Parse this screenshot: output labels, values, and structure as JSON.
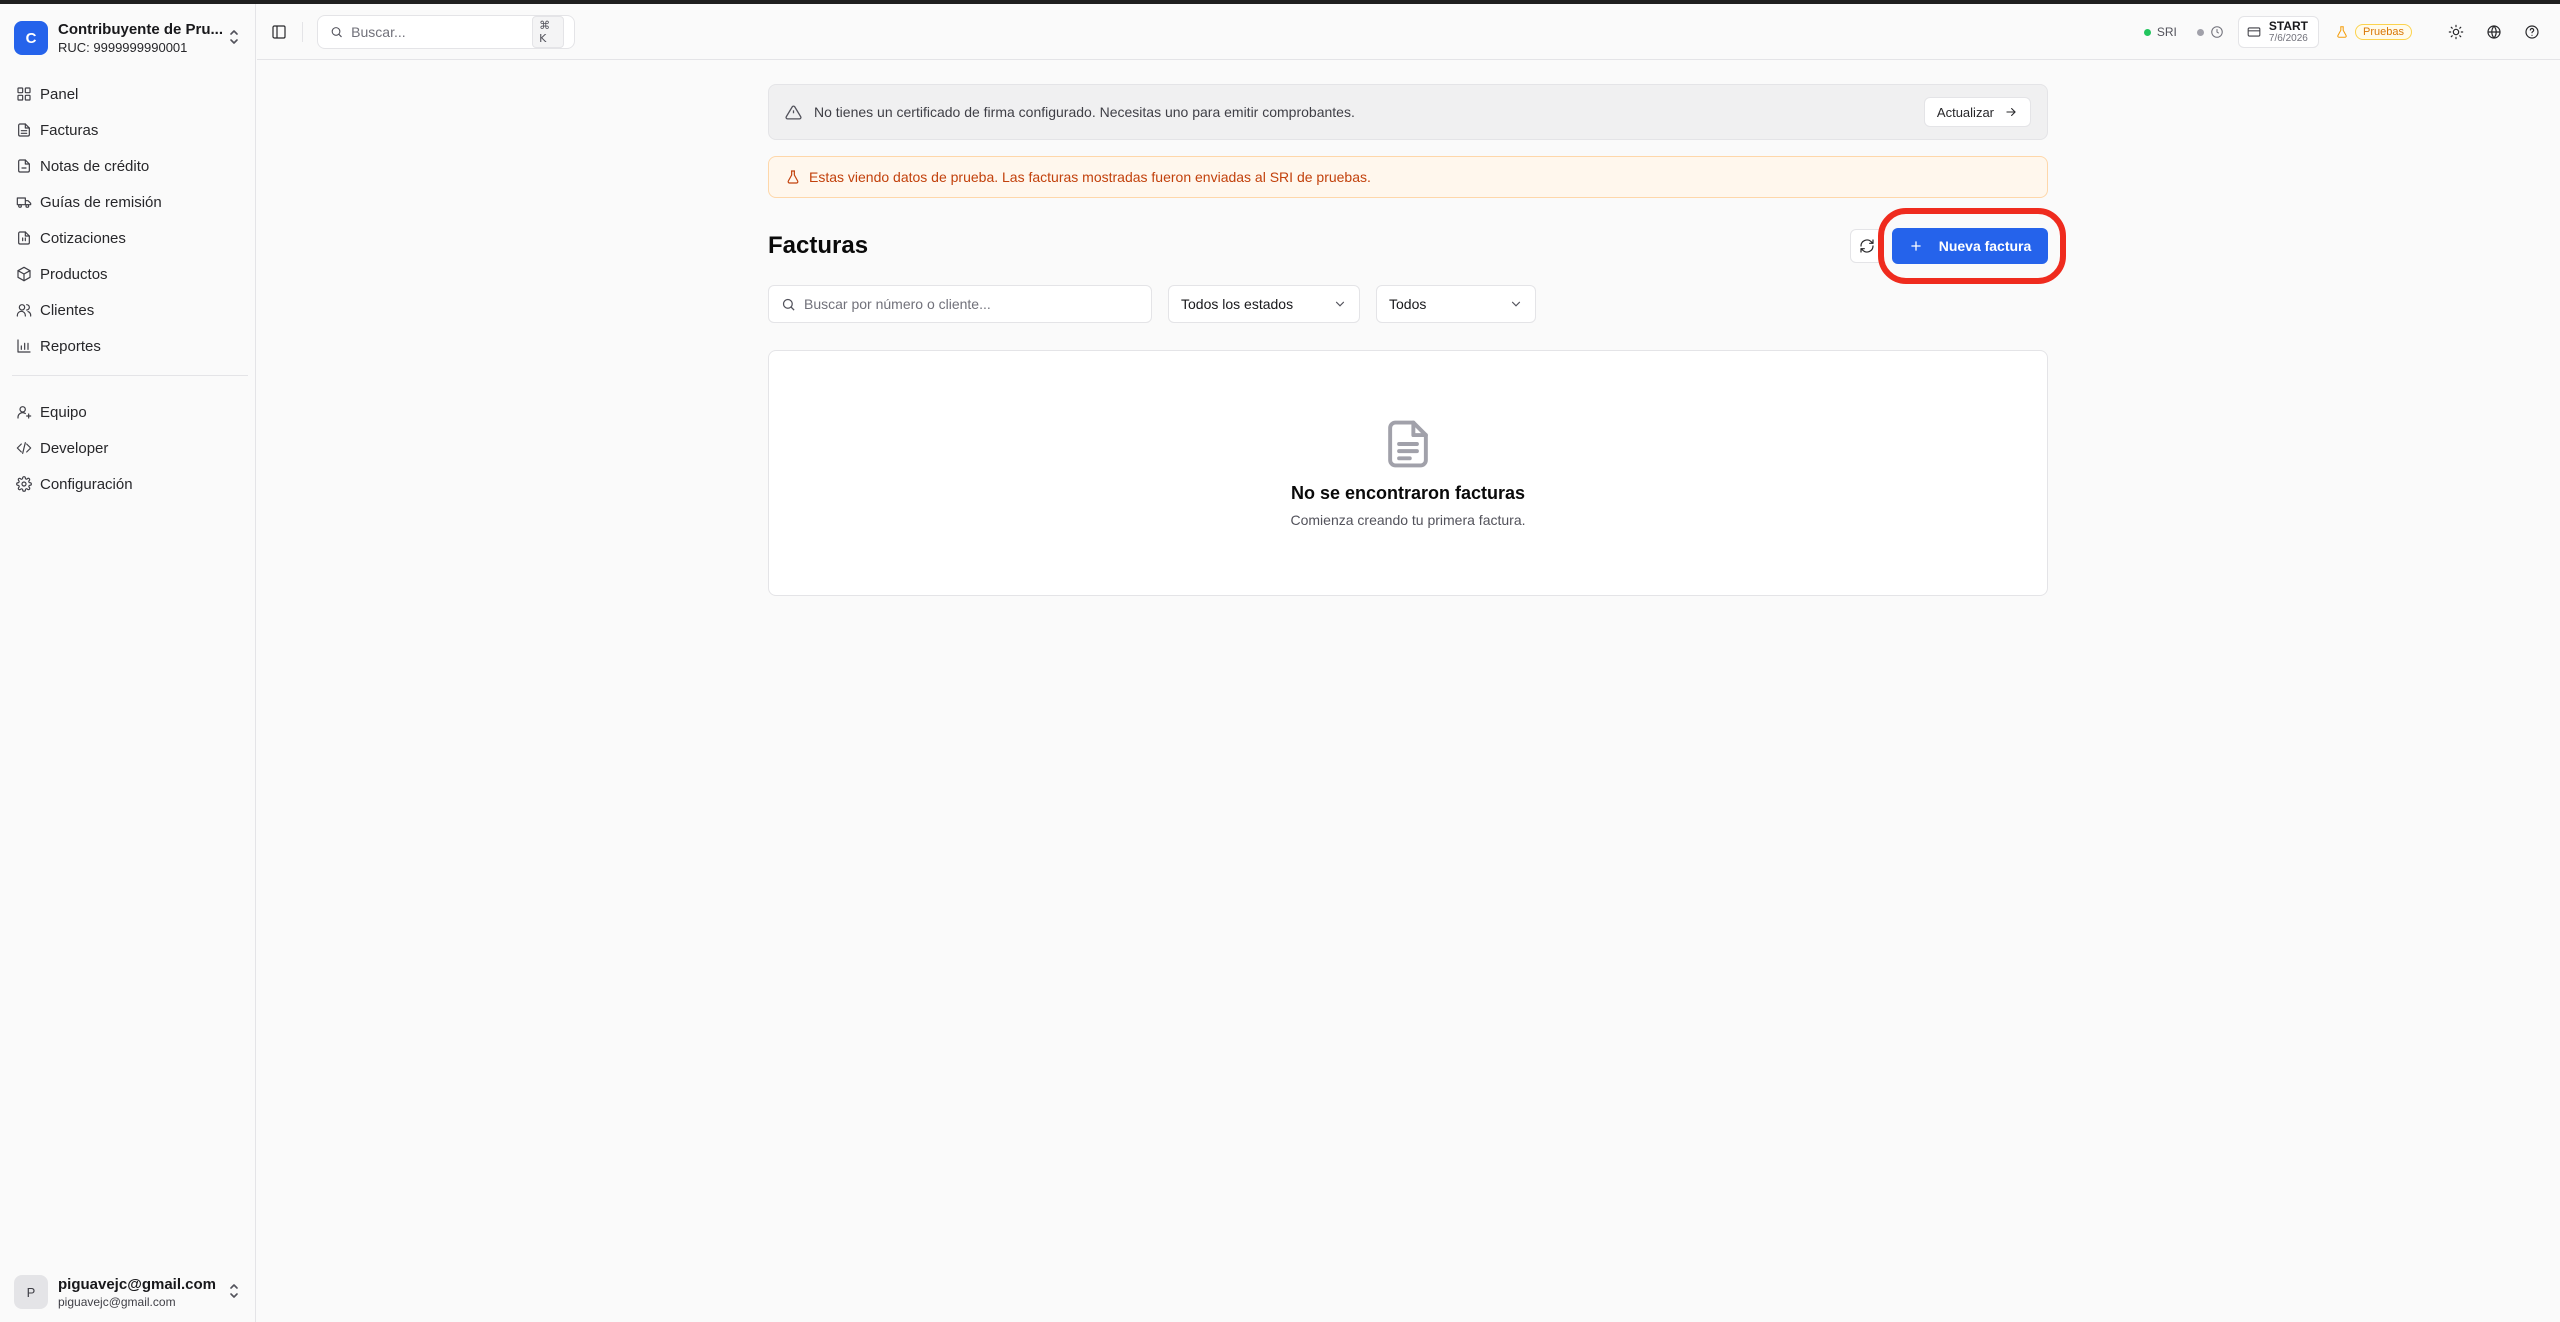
{
  "org": {
    "initial": "C",
    "name": "Contribuyente de Pru...",
    "ruc": "RUC: 9999999990001"
  },
  "nav": {
    "primary": [
      {
        "label": "Panel",
        "icon": "grid-icon"
      },
      {
        "label": "Facturas",
        "icon": "file-text-icon"
      },
      {
        "label": "Notas de crédito",
        "icon": "file-minus-icon"
      },
      {
        "label": "Guías de remisión",
        "icon": "truck-icon"
      },
      {
        "label": "Cotizaciones",
        "icon": "file-quote-icon"
      },
      {
        "label": "Productos",
        "icon": "package-icon"
      },
      {
        "label": "Clientes",
        "icon": "users-icon"
      },
      {
        "label": "Reportes",
        "icon": "bar-chart-icon"
      }
    ],
    "secondary": [
      {
        "label": "Equipo",
        "icon": "user-cog-icon"
      },
      {
        "label": "Developer",
        "icon": "code-icon"
      },
      {
        "label": "Configuración",
        "icon": "gear-icon"
      }
    ]
  },
  "user": {
    "initial": "P",
    "name": "piguavejc@gmail.com",
    "email": "piguavejc@gmail.com"
  },
  "header": {
    "search_placeholder": "Buscar...",
    "shortcut": "⌘ K",
    "sri_label": "SRI",
    "plan_name": "START",
    "plan_date": "7/6/2026",
    "env_badge": "Pruebas"
  },
  "alerts": {
    "certificate": "No tienes un certificado de firma configurado. Necesitas uno para emitir comprobantes.",
    "update_label": "Actualizar",
    "test_data": "Estas viendo datos de prueba. Las facturas mostradas fueron enviadas al SRI de pruebas."
  },
  "page": {
    "title": "Facturas",
    "new_button": "Nueva factura",
    "search_placeholder": "Buscar por número o cliente...",
    "status_filter": "Todos los estados",
    "type_filter": "Todos",
    "empty_title": "No se encontraron facturas",
    "empty_subtitle": "Comienza creando tu primera factura."
  },
  "colors": {
    "accent": "#2563eb",
    "highlight": "#ef2b1e",
    "warning": "#c2410c"
  }
}
